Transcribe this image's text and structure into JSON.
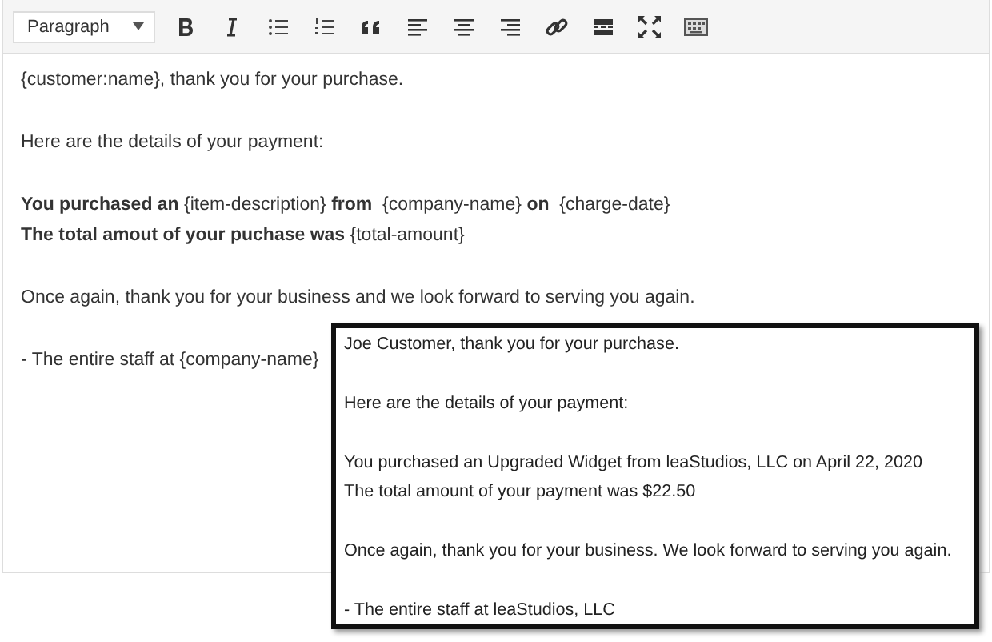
{
  "toolbar": {
    "format_select": "Paragraph"
  },
  "editor": {
    "paragraphs": [
      [
        "{customer:name}, thank you for your purchase."
      ],
      [
        "Here are the details of your payment:"
      ],
      [
        "**You purchased an** {item-description} **from**  {company-name} **on**  {charge-date}",
        "**The total amout of your puchase was** {total-amount}"
      ],
      [
        "Once again, thank you for your business and we look forward to serving you again."
      ],
      [
        "- The entire staff at {company-name}"
      ]
    ]
  },
  "preview": {
    "paragraphs": [
      [
        "Joe Customer, thank you for your purchase."
      ],
      [
        "Here are the details of your payment:"
      ],
      [
        "You purchased an Upgraded Widget from leaStudios, LLC on April 22, 2020",
        "The total amount of your payment was $22.50"
      ],
      [
        "Once again, thank you for your business. We look forward to serving you again."
      ],
      [
        "- The entire staff at leaStudios, LLC"
      ]
    ]
  }
}
